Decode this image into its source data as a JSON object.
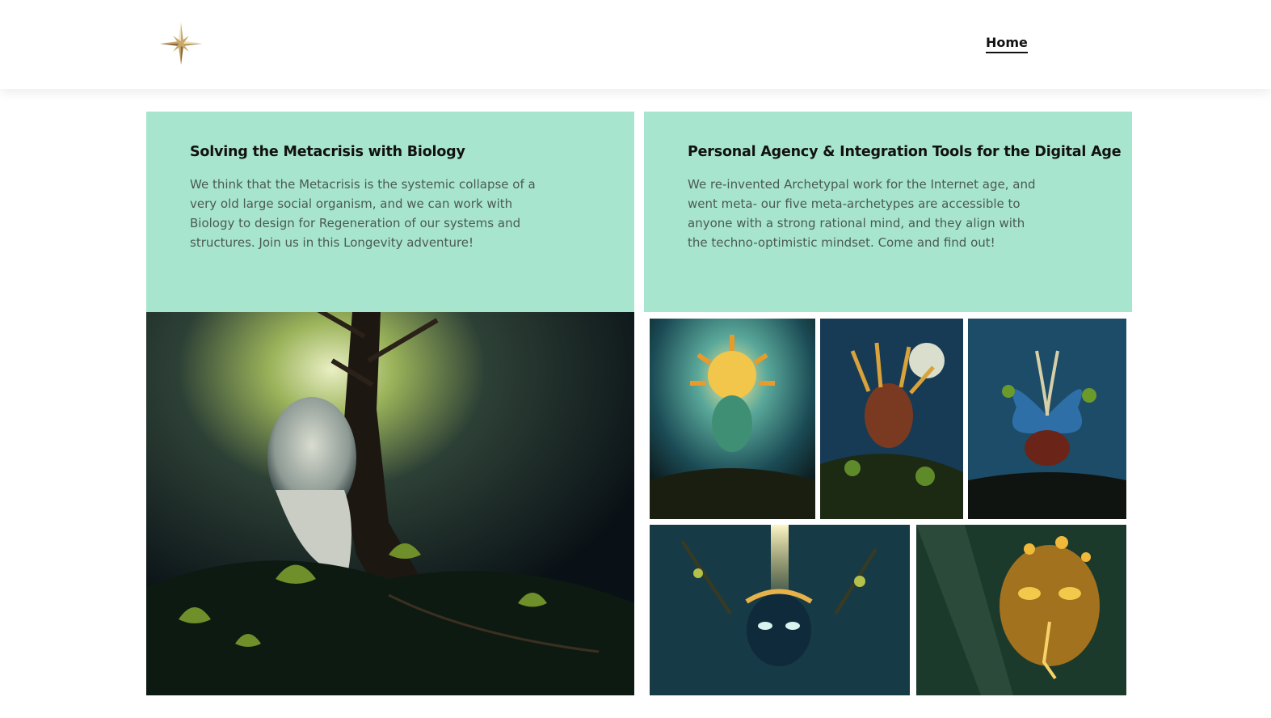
{
  "header": {
    "logo_icon": "compass-star-icon",
    "nav": {
      "home_label": "Home"
    }
  },
  "cards": [
    {
      "title": "Solving the Metacrisis with Biology",
      "body": "We think that the Metacrisis is the systemic collapse of a very old large social organism, and we can work with Biology to design for Regeneration of our systems and structures. Join us in this Longevity adventure!"
    },
    {
      "title": "Personal Agency & Integration Tools for the Digital Age",
      "body": "We re-invented Archetypal work for the Internet age, and went meta- our five meta-archetypes are accessible to anyone with a strong rational mind, and they align with the techno-optimistic mindset. Come and find out!"
    }
  ],
  "colors": {
    "card_background": "#a8e5ce",
    "title_text": "#111111",
    "body_text": "#4a5a55",
    "logo_gold": "#c9a86a"
  }
}
